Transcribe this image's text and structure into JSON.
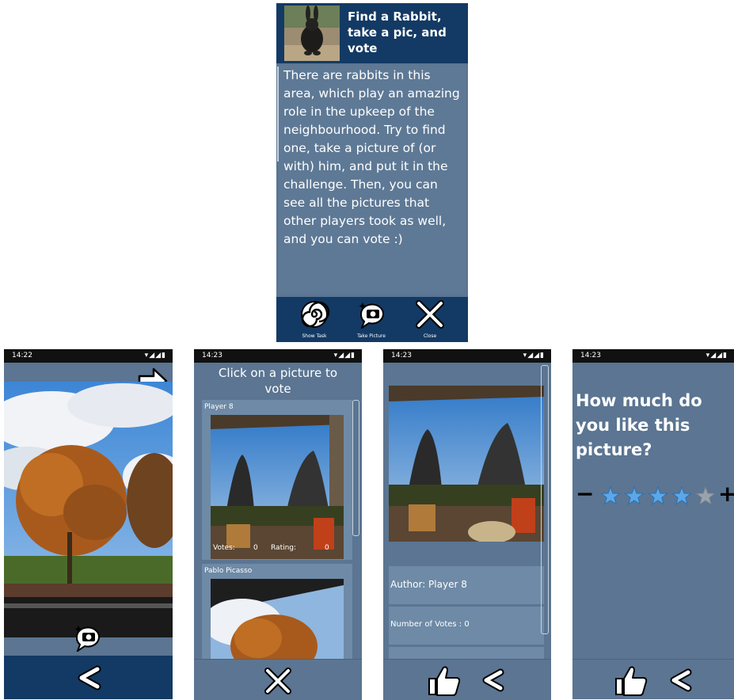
{
  "top_panel": {
    "title": "Find a Rabbit, take a pic, and vote",
    "description": "There are rabbits in this area, which play an amazing role in the upkeep of the neighbourhood. Try to find one, take a picture of (or with) him, and put it in the challenge. Then, you can see all the pictures that other players took as well, and you can vote :)",
    "buttons": {
      "show_task": "Show Task",
      "take_picture": "Take Picture",
      "close": "Close"
    }
  },
  "screen1": {
    "time": "14:22",
    "status_icons": "▾◢◢▮"
  },
  "screen2": {
    "time": "14:23",
    "status_icons": "▾◢◢▮",
    "header": "Click on a picture to vote",
    "cards": [
      {
        "player": "Player 8",
        "votes_label": "Votes:",
        "votes_value": "0",
        "rating_label": "Rating:",
        "rating_value": "0"
      },
      {
        "player": "Pablo Picasso"
      }
    ]
  },
  "screen3": {
    "time": "14:23",
    "status_icons": "▾◢◢▮",
    "author": "Author: Player 8",
    "votes": "Number of Votes : 0"
  },
  "screen4": {
    "time": "14:23",
    "status_icons": "▾◢◢▮",
    "question": "How much do you like this picture?",
    "minus": "−",
    "plus": "+",
    "rating": {
      "value": 4,
      "max": 5
    }
  },
  "colors": {
    "navy": "#133a64",
    "slate": "#5b7592",
    "card": "#6e8aa6",
    "star_filled": "#5aa8e8",
    "star_empty": "#9aa3ad"
  }
}
